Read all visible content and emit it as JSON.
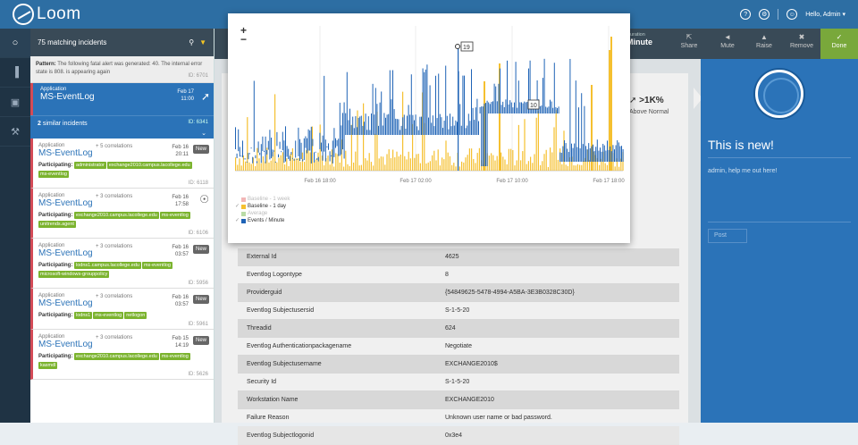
{
  "app": {
    "name": "Loom"
  },
  "top": {
    "greeting": "Hello, Admin ▾",
    "help_glyph": "?",
    "gear_glyph": "⚙",
    "user_glyph": "☺"
  },
  "nav": {
    "icons": [
      "bell-icon",
      "bar-chart-icon",
      "network-icon",
      "tools-icon"
    ],
    "glyphs": [
      "○",
      "▐",
      "▣",
      "⚒"
    ]
  },
  "incidents": {
    "count_label": "75 matching incidents",
    "pattern": {
      "label": "Pattern:",
      "text": "The following fatal alert was generated: 40. The internal error state is 808. is appearing again",
      "id": "ID: 6701"
    },
    "selected": {
      "app": "Application",
      "name": "MS-EventLog",
      "date": "Feb 17",
      "time": "11:00",
      "status_icon": "spike-icon"
    },
    "similar": {
      "count": "2",
      "text": "similar incidents",
      "id": "ID: 6341"
    },
    "cards": [
      {
        "app": "Application",
        "correlations": "+ 5 correlations",
        "name": "MS-EventLog",
        "date": "Feb 16",
        "time": "20:11",
        "badge": "New",
        "participating": "Participating:",
        "tags": [
          "administrator",
          "exchange2010.campus.lacollege.edu",
          "ms-eventlog"
        ],
        "id": "ID: 6118"
      },
      {
        "app": "Application",
        "correlations": "+ 3 correlations",
        "name": "MS-EventLog",
        "date": "Feb 16",
        "time": "17:58",
        "badge": "",
        "participating": "Participating:",
        "tags": [
          "exchange2010.campus.lacollege.edu",
          "ms-eventlog",
          "unitrends.agent"
        ],
        "id": "ID: 6106"
      },
      {
        "app": "Application",
        "correlations": "+ 3 correlations",
        "name": "MS-EventLog",
        "date": "Feb 16",
        "time": "03:57",
        "badge": "New",
        "participating": "Participating:",
        "tags": [
          "lodns1.campus.lacollege.edu",
          "ms-eventlog",
          "microsoft-windows-grouppolicy"
        ],
        "id": "ID: 5956"
      },
      {
        "app": "Application",
        "correlations": "+ 3 correlations",
        "name": "MS-EventLog",
        "date": "Feb 16",
        "time": "03:57",
        "badge": "New",
        "participating": "Participating:",
        "tags": [
          "lodns1",
          "ms-eventlog",
          "netlogon"
        ],
        "id": "ID: 5961"
      },
      {
        "app": "Application",
        "correlations": "+ 3 correlations",
        "name": "MS-EventLog",
        "date": "Feb 15",
        "time": "14:19",
        "badge": "New",
        "participating": "Participating:",
        "tags": [
          "exchange2010.campus.lacollege.edu",
          "ms-eventlog",
          "kasmdl"
        ],
        "id": "ID: 5626"
      }
    ]
  },
  "toolbar": {
    "duration_label": "Duration",
    "duration_value": "Minute",
    "buttons": [
      {
        "label": "Share",
        "glyph": "⇱"
      },
      {
        "label": "Mute",
        "glyph": "◄"
      },
      {
        "label": "Raise",
        "glyph": "▲"
      },
      {
        "label": "Remove",
        "glyph": "✖"
      }
    ],
    "done_label": "Done",
    "done_glyph": "✓"
  },
  "summary": {
    "value": ">1K%",
    "label": "Above Normal"
  },
  "details": [
    {
      "k": "External Id",
      "v": "4625"
    },
    {
      "k": "Eventlog Logontype",
      "v": "8"
    },
    {
      "k": "Providerguid",
      "v": "{54849625-5478-4994-A5BA-3E3B0328C30D}"
    },
    {
      "k": "Eventlog Subjectusersid",
      "v": "S-1-5-20"
    },
    {
      "k": "Threadid",
      "v": "624"
    },
    {
      "k": "Eventlog Authenticationpackagename",
      "v": "Negotiate"
    },
    {
      "k": "Eventlog Subjectusername",
      "v": "EXCHANGE2010$"
    },
    {
      "k": "Security Id",
      "v": "S-1-5-20"
    },
    {
      "k": "Workstation Name",
      "v": "EXCHANGE2010"
    },
    {
      "k": "Failure Reason",
      "v": "Unknown user name or bad password."
    },
    {
      "k": "Eventlog Subjectlogonid",
      "v": "0x3e4"
    }
  ],
  "chat": {
    "title": "This is new!",
    "message": "admin, help me out here!",
    "post_label": "Post"
  },
  "popup": {
    "zoom_in": "+",
    "zoom_out": "−"
  },
  "chart_data": {
    "type": "bar",
    "title": "",
    "xlabel": "",
    "ylabel": "",
    "x_ticks": [
      "Feb 16 18:00",
      "Feb 17 02:00",
      "Feb 17 10:00",
      "Feb 17 18:00"
    ],
    "series": [
      {
        "name": "Baseline - 1 week",
        "color": "#f2b6b6",
        "enabled": false
      },
      {
        "name": "Baseline - 1 day",
        "color": "#f5c030",
        "enabled": true
      },
      {
        "name": "Average",
        "color": "#b9dba6",
        "enabled": false
      },
      {
        "name": "Events / Minute",
        "color": "#1f63b6",
        "enabled": true
      }
    ],
    "annotations": [
      {
        "label": "19"
      },
      {
        "label": "10"
      }
    ],
    "grid": true,
    "legend": "bottom-left"
  }
}
